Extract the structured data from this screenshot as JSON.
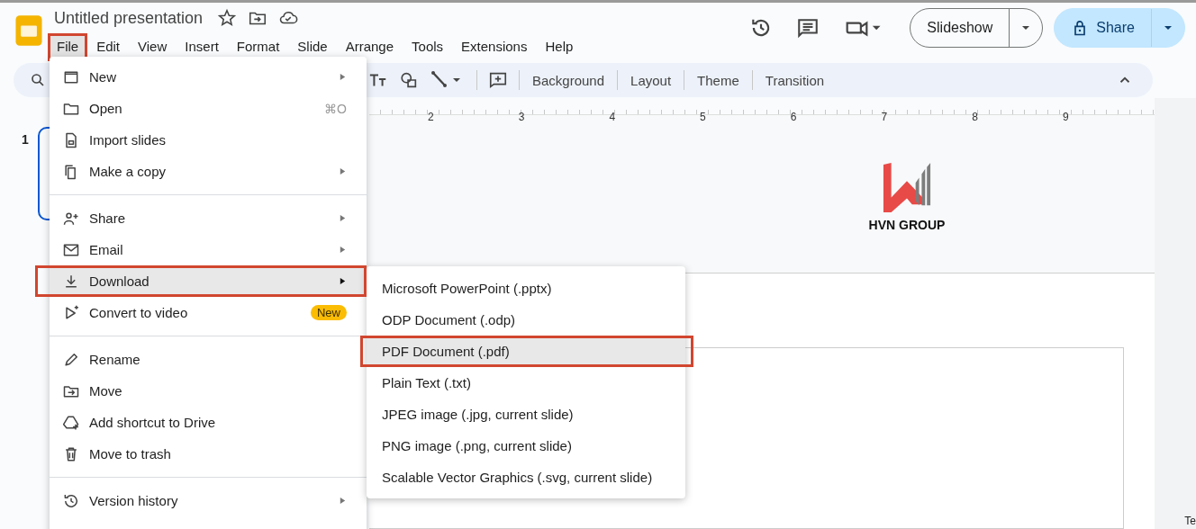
{
  "header": {
    "title": "Untitled presentation",
    "menu_bar": [
      {
        "label": "File",
        "selected": true,
        "marked": true
      },
      {
        "label": "Edit",
        "selected": false,
        "marked": false
      },
      {
        "label": "View",
        "selected": false,
        "marked": false
      },
      {
        "label": "Insert",
        "selected": false,
        "marked": false
      },
      {
        "label": "Format",
        "selected": false,
        "marked": false
      },
      {
        "label": "Slide",
        "selected": false,
        "marked": false
      },
      {
        "label": "Arrange",
        "selected": false,
        "marked": false
      },
      {
        "label": "Tools",
        "selected": false,
        "marked": false
      },
      {
        "label": "Extensions",
        "selected": false,
        "marked": false
      },
      {
        "label": "Help",
        "selected": false,
        "marked": false
      }
    ],
    "slideshow_button": "Slideshow",
    "share_button": "Share"
  },
  "toolbar": {
    "buttons": [
      "Background",
      "Layout",
      "Theme",
      "Transition"
    ]
  },
  "ruler": {
    "labels": [
      "2",
      "3",
      "4",
      "5",
      "6",
      "7",
      "8",
      "9"
    ]
  },
  "filmstrip": {
    "slide_number": "1"
  },
  "slide": {
    "logo_text": "HVN GROUP"
  },
  "edge_text": "Te",
  "file_menu": {
    "sections": [
      {
        "items": [
          {
            "label": "New",
            "submenu": true,
            "highlighted": false,
            "marked": false
          },
          {
            "label": "Open",
            "shortcut": "⌘O",
            "submenu": false,
            "highlighted": false,
            "marked": false
          },
          {
            "label": "Import slides",
            "submenu": false,
            "highlighted": false,
            "marked": false
          },
          {
            "label": "Make a copy",
            "submenu": true,
            "highlighted": false,
            "marked": false
          }
        ]
      },
      {
        "items": [
          {
            "label": "Share",
            "submenu": true,
            "highlighted": false,
            "marked": false
          },
          {
            "label": "Email",
            "submenu": true,
            "highlighted": false,
            "marked": false
          },
          {
            "label": "Download",
            "submenu": true,
            "highlighted": true,
            "marked": true
          },
          {
            "label": "Convert to video",
            "badge": "New",
            "submenu": false,
            "highlighted": false,
            "marked": false
          }
        ]
      },
      {
        "items": [
          {
            "label": "Rename",
            "submenu": false,
            "highlighted": false,
            "marked": false
          },
          {
            "label": "Move",
            "submenu": false,
            "highlighted": false,
            "marked": false
          },
          {
            "label": "Add shortcut to Drive",
            "submenu": false,
            "highlighted": false,
            "marked": false
          },
          {
            "label": "Move to trash",
            "submenu": false,
            "highlighted": false,
            "marked": false
          }
        ]
      },
      {
        "items": [
          {
            "label": "Version history",
            "submenu": true,
            "highlighted": false,
            "marked": false
          }
        ]
      }
    ]
  },
  "download_submenu": {
    "items": [
      {
        "label": "Microsoft PowerPoint (.pptx)",
        "highlighted": false,
        "marked": false
      },
      {
        "label": "ODP Document (.odp)",
        "highlighted": false,
        "marked": false
      },
      {
        "label": "PDF Document (.pdf)",
        "highlighted": true,
        "marked": true
      },
      {
        "label": "Plain Text (.txt)",
        "highlighted": false,
        "marked": false
      },
      {
        "label": "JPEG image (.jpg, current slide)",
        "highlighted": false,
        "marked": false
      },
      {
        "label": "PNG image (.png, current slide)",
        "highlighted": false,
        "marked": false
      },
      {
        "label": "Scalable Vector Graphics (.svg, current slide)",
        "highlighted": false,
        "marked": false
      }
    ]
  }
}
